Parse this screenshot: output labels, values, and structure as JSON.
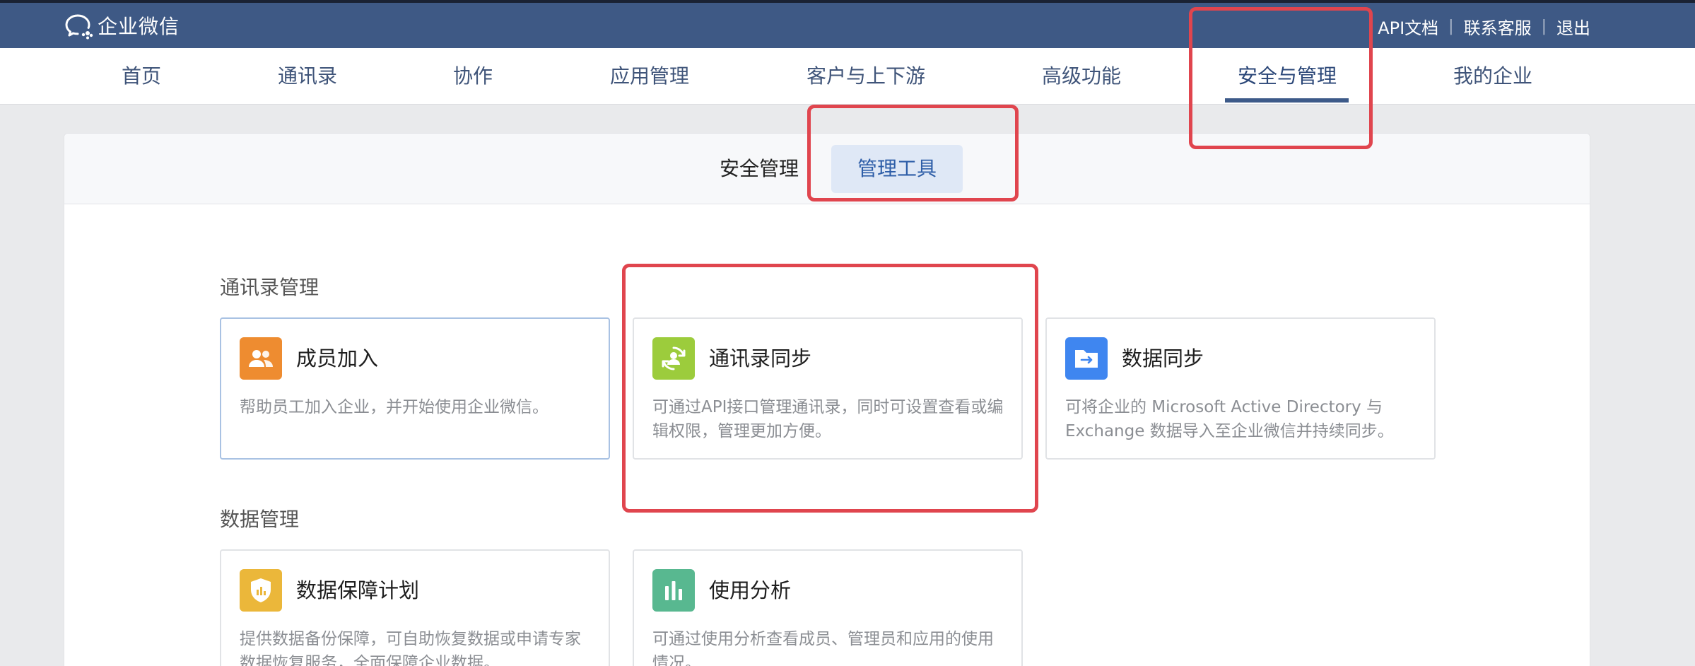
{
  "app": {
    "name": "企业微信"
  },
  "header": {
    "links": [
      "API文档",
      "联系客服",
      "退出"
    ],
    "separator": "|"
  },
  "nav": {
    "items": [
      {
        "label": "首页"
      },
      {
        "label": "通讯录"
      },
      {
        "label": "协作"
      },
      {
        "label": "应用管理"
      },
      {
        "label": "客户与上下游"
      },
      {
        "label": "高级功能"
      },
      {
        "label": "安全与管理",
        "active": true
      },
      {
        "label": "我的企业"
      }
    ]
  },
  "subtabs": [
    {
      "label": "安全管理"
    },
    {
      "label": "管理工具",
      "active": true
    }
  ],
  "sections": [
    {
      "title": "通讯录管理",
      "tiles": [
        {
          "title": "成员加入",
          "desc": "帮助员工加入企业，并开始使用企业微信。",
          "icon": "members-icon",
          "color": "#ee8c30"
        },
        {
          "title": "通讯录同步",
          "desc": "可通过API接口管理通讯录，同时可设置查看或编辑权限，管理更加方便。",
          "icon": "sync-contacts-icon",
          "color": "#9ccc3c"
        },
        {
          "title": "数据同步",
          "desc": "可将企业的 Microsoft Active Directory 与 Exchange 数据导入至企业微信并持续同步。",
          "icon": "folder-sync-icon",
          "color": "#3f86f0"
        }
      ]
    },
    {
      "title": "数据管理",
      "tiles": [
        {
          "title": "数据保障计划",
          "desc": "提供数据备份保障，可自助恢复数据或申请专家数据恢复服务，全面保障企业数据。",
          "icon": "shield-chart-icon",
          "color": "#ebb73a"
        },
        {
          "title": "使用分析",
          "desc": "可通过使用分析查看成员、管理员和应用的使用情况。",
          "icon": "bar-chart-icon",
          "color": "#58b890"
        }
      ]
    }
  ],
  "annotation_color": "#e0454e"
}
